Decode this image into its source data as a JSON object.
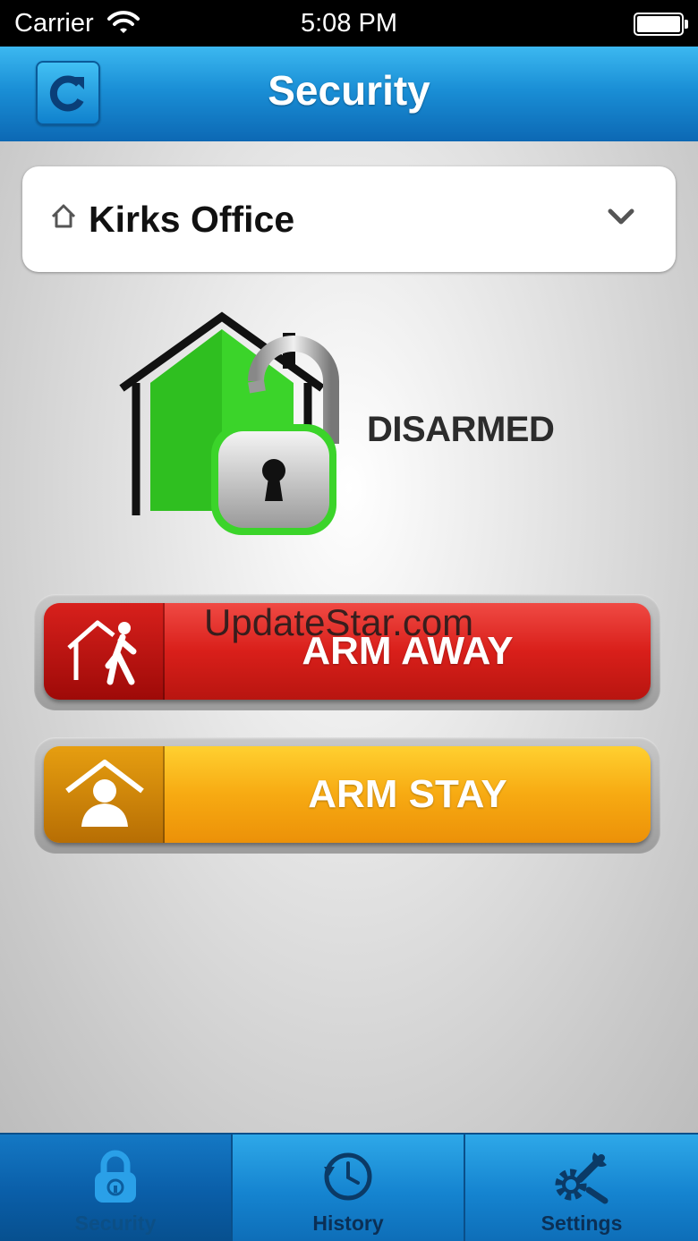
{
  "status_bar": {
    "carrier": "Carrier",
    "time": "5:08 PM"
  },
  "nav": {
    "title": "Security",
    "refresh_icon": "refresh-icon"
  },
  "location": {
    "name": "Kirks Office"
  },
  "security_status": {
    "label": "DISARMED",
    "state_color": "#34c724"
  },
  "actions": {
    "arm_away": {
      "label": "ARM AWAY",
      "color": "#d91f1a"
    },
    "arm_stay": {
      "label": "ARM STAY",
      "color": "#f7aa12"
    }
  },
  "watermark": "UpdateStar.com",
  "tabs": [
    {
      "label": "Security",
      "icon": "padlock-icon",
      "active": true
    },
    {
      "label": "History",
      "icon": "history-clock-icon",
      "active": false
    },
    {
      "label": "Settings",
      "icon": "settings-gear-wrench-icon",
      "active": false
    }
  ],
  "colors": {
    "accent": "#1a8fd6",
    "tab_bar": "#1584d0"
  }
}
